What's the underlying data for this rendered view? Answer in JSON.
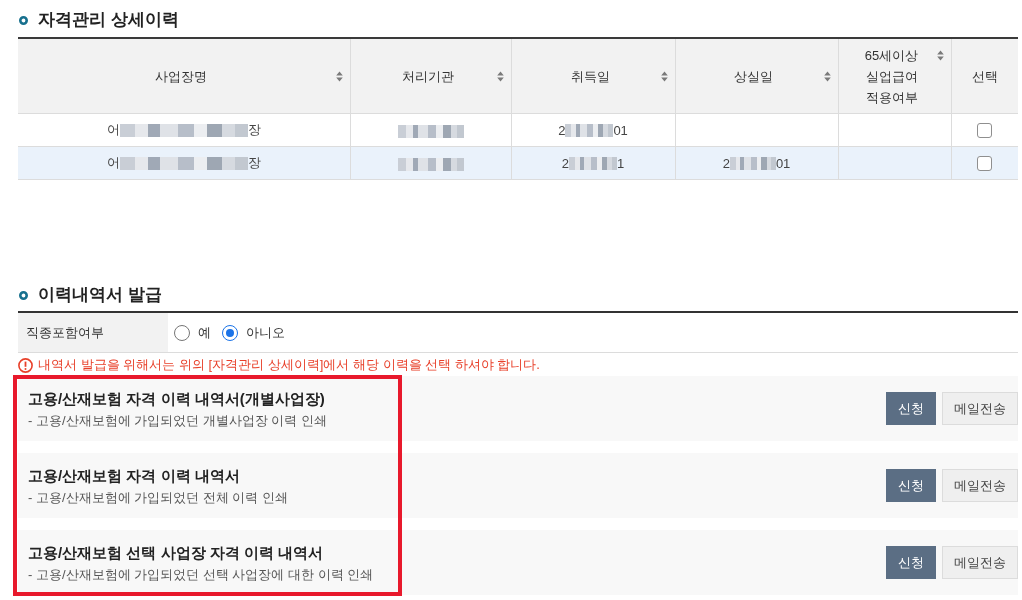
{
  "detail_section": {
    "title": "자격관리 상세이력",
    "table": {
      "columns": [
        {
          "label": "사업장명",
          "sortable": true
        },
        {
          "label": "처리기관",
          "sortable": true
        },
        {
          "label": "취득일",
          "sortable": true
        },
        {
          "label": "상실일",
          "sortable": true
        },
        {
          "label": "65세이상 실업급여 적용여부",
          "sortable": true
        },
        {
          "label": "선택",
          "sortable": false
        }
      ],
      "rows": [
        {
          "selected": false,
          "checked": false,
          "workplace": [
            {
              "kind": "text",
              "text": "어"
            },
            {
              "kind": "redacted"
            },
            {
              "kind": "text",
              "text": "장"
            }
          ],
          "agency": [
            {
              "kind": "redacted"
            }
          ],
          "acquired_date": [
            {
              "kind": "text",
              "text": "2"
            },
            {
              "kind": "redacted"
            },
            {
              "kind": "text",
              "text": "01"
            }
          ]
        },
        {
          "selected": true,
          "checked": false,
          "workplace": [
            {
              "kind": "text",
              "text": "어"
            },
            {
              "kind": "redacted"
            },
            {
              "kind": "text",
              "text": "장"
            }
          ],
          "agency": [
            {
              "kind": "redacted"
            }
          ],
          "acquired_date": [
            {
              "kind": "text",
              "text": "2"
            },
            {
              "kind": "redacted"
            },
            {
              "kind": "text",
              "text": "1"
            }
          ],
          "lost_date": [
            {
              "kind": "text",
              "text": "2"
            },
            {
              "kind": "redacted"
            },
            {
              "kind": "text",
              "text": "01"
            }
          ]
        }
      ]
    }
  },
  "issue_section": {
    "title": "이력내역서 발급",
    "job_type_option": {
      "label": "직종포함여부",
      "options": [
        {
          "label": "예",
          "selected": false
        },
        {
          "label": "아니오",
          "selected": true
        }
      ]
    },
    "warning": "내역서 발급을 위해서는 위의 [자격관리 상세이력]에서 해당 이력을 선택 하셔야 합니다.",
    "documents": {
      "highlighted": true,
      "items": [
        {
          "title": "고용/산재보험 자격 이력 내역서(개별사업장)",
          "description": "- 고용/산재보험에 가입되었던 개별사업장 이력 인쇄",
          "buttons": [
            {
              "label": "신청",
              "kind": "primary"
            },
            {
              "label": "메일전송",
              "kind": "secondary"
            }
          ]
        },
        {
          "title": "고용/산재보험 자격 이력 내역서",
          "description": "- 고용/산재보험에 가입되었던 전체 이력 인쇄",
          "buttons": [
            {
              "label": "신청",
              "kind": "primary"
            },
            {
              "label": "메일전송",
              "kind": "secondary"
            }
          ]
        },
        {
          "title": "고용/산재보험 선택 사업장 자격 이력 내역서",
          "description": "- 고용/산재보험에 가입되었던 선택 사업장에 대한 이력 인쇄",
          "buttons": [
            {
              "label": "신청",
              "kind": "primary"
            },
            {
              "label": "메일전송",
              "kind": "secondary"
            }
          ]
        }
      ]
    }
  }
}
